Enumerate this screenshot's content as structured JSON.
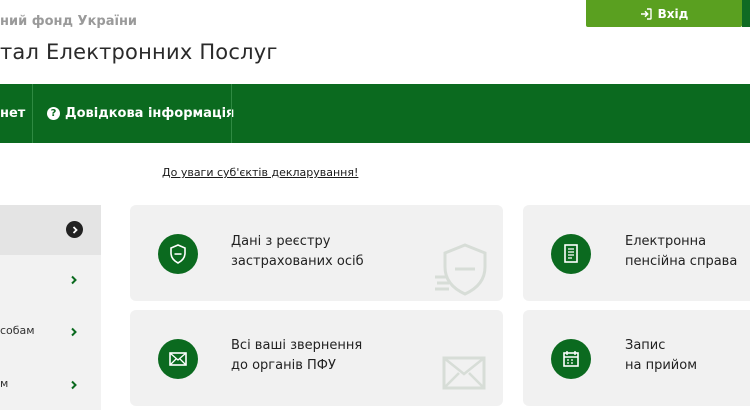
{
  "header": {
    "org_name": "ний фонд України",
    "portal_title": "тал Електронних Послуг",
    "login_label": "Вхід"
  },
  "nav": {
    "item1_label": "нет",
    "item2_label": "Довідкова інформація"
  },
  "notice_link": "До уваги суб'єктів декларування!",
  "sidebar": {
    "items": [
      {
        "label": ""
      },
      {
        "label": ""
      },
      {
        "label": "собам"
      },
      {
        "label": "м"
      }
    ]
  },
  "cards": [
    {
      "line1": "Дані з реєстру",
      "line2": "застрахованих осіб",
      "icon": "shield-icon"
    },
    {
      "line1": "Електронна",
      "line2": "пенсійна справа",
      "icon": "document-icon"
    },
    {
      "line1": "Всі ваші звернення",
      "line2": "до органів ПФУ",
      "icon": "envelope-icon"
    },
    {
      "line1": "Запис",
      "line2": "на прийом",
      "icon": "calendar-icon"
    }
  ],
  "colors": {
    "brand_green": "#0b6a1f",
    "login_green": "#5aa020",
    "card_bg": "#f1f1f1"
  }
}
